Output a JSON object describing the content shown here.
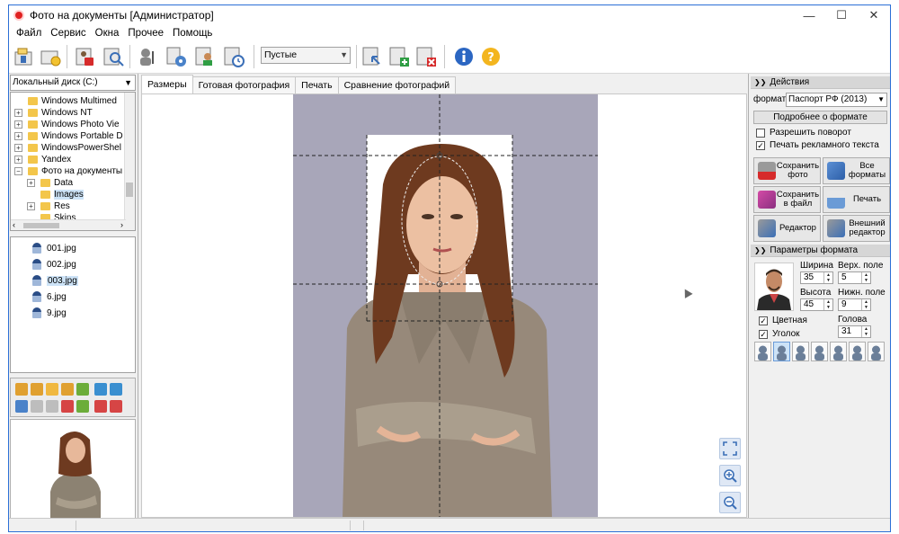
{
  "window": {
    "title": "Фото на документы  [Администратор]",
    "controls": {
      "minimize": "—",
      "maximize": "☐",
      "close": "✕"
    }
  },
  "menu": [
    "Файл",
    "Сервис",
    "Окна",
    "Прочее",
    "Помощь"
  ],
  "toolbar": {
    "filter_select": "Пустые",
    "icons": [
      "open-folder-icon",
      "new-folder-icon",
      "save-photo-icon",
      "search-image-icon",
      "user-settings-icon",
      "gear-icon",
      "person-card-icon",
      "calendar-clock-icon",
      "select-arrow-icon",
      "add-green-icon",
      "delete-red-icon",
      "info-icon",
      "help-icon"
    ]
  },
  "left": {
    "drive": "Локальный диск (C:)",
    "tree": [
      {
        "label": "Windows Multimed",
        "level": 1,
        "expander": ""
      },
      {
        "label": "Windows NT",
        "level": 1,
        "expander": "+"
      },
      {
        "label": "Windows Photo Vie",
        "level": 1,
        "expander": "+"
      },
      {
        "label": "Windows Portable D",
        "level": 1,
        "expander": "+"
      },
      {
        "label": "WindowsPowerShel",
        "level": 1,
        "expander": "+"
      },
      {
        "label": "Yandex",
        "level": 1,
        "expander": "+"
      },
      {
        "label": "Фото на документы",
        "level": 1,
        "expander": "−"
      },
      {
        "label": "Data",
        "level": 2,
        "expander": "+"
      },
      {
        "label": "Images",
        "level": 2,
        "expander": "",
        "selected": true
      },
      {
        "label": "Res",
        "level": 2,
        "expander": "+"
      },
      {
        "label": "Skins",
        "level": 2,
        "expander": ""
      }
    ],
    "files": [
      {
        "name": "001.jpg"
      },
      {
        "name": "002.jpg"
      },
      {
        "name": "003.jpg",
        "selected": true
      },
      {
        "name": "6.jpg"
      },
      {
        "name": "9.jpg"
      }
    ]
  },
  "center": {
    "tabs": [
      {
        "label": "Размеры",
        "active": true
      },
      {
        "label": "Готовая фотография"
      },
      {
        "label": "Печать"
      },
      {
        "label": "Сравнение фотографий"
      }
    ]
  },
  "right": {
    "actions_header": "Действия",
    "format_label": "формат",
    "format_value": "Паспорт РФ (2013)",
    "format_details_button": "Подробнее о формате",
    "allow_rotation": {
      "label": "Разрешить поворот",
      "checked": false
    },
    "print_ad_text": {
      "label": "Печать рекламного текста",
      "checked": true
    },
    "buttons": {
      "save_photo": "Сохранить фото",
      "all_formats": "Все форматы",
      "save_to_file": "Сохранить в файл",
      "print": "Печать",
      "editor": "Редактор",
      "external_editor": "Внешний редактор"
    },
    "params_header": "Параметры формата",
    "width_label": "Ширина",
    "width_value": "35",
    "top_margin_label": "Верх. поле",
    "top_margin_value": "5",
    "height_label": "Высота",
    "height_value": "45",
    "bottom_margin_label": "Нижн. поле",
    "bottom_margin_value": "9",
    "head_label": "Голова",
    "head_value": "31",
    "color": {
      "label": "Цветная",
      "checked": true
    },
    "corner": {
      "label": "Уголок",
      "checked": true
    },
    "head_styles": 7
  },
  "colors": {
    "accent": "#2b6fd6",
    "photo_background": "#a8a6b9",
    "selection": "#cde3f7"
  }
}
